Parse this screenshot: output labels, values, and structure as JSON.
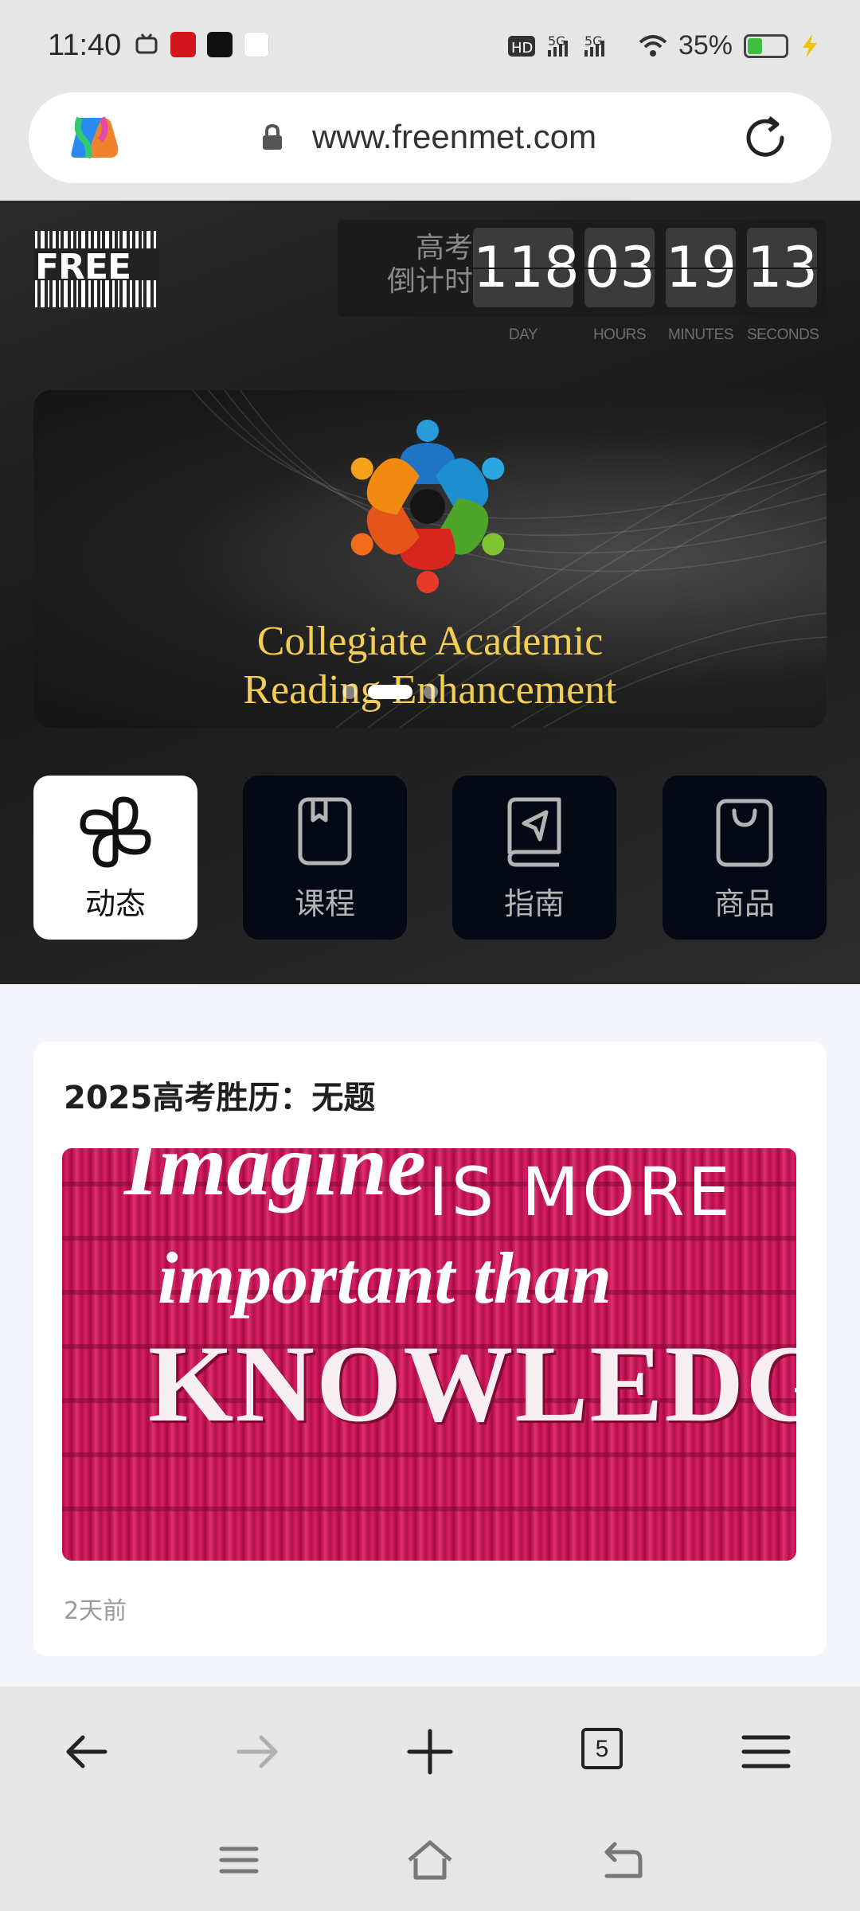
{
  "status_bar": {
    "time": "11:40",
    "network": "HD 5G 5G",
    "battery": "35%"
  },
  "address_bar": {
    "url": "www.freenmet.com"
  },
  "site": {
    "logo_text": "FREE",
    "countdown": {
      "label_line1": "高考",
      "label_line2": "倒计时",
      "days": "118",
      "hours": "03",
      "minutes": "19",
      "seconds": "13",
      "unit_day": "DAY",
      "unit_hours": "HOURS",
      "unit_minutes": "MINUTES",
      "unit_seconds": "SECONDS"
    },
    "banner": {
      "title_line1": "Collegiate Academic",
      "title_line2": "Reading Enhancement",
      "active_slide": 2,
      "slide_count": 4
    },
    "nav": [
      {
        "label": "动态",
        "icon": "pinwheel-icon",
        "active": true
      },
      {
        "label": "课程",
        "icon": "book-icon",
        "active": false
      },
      {
        "label": "指南",
        "icon": "guide-book-icon",
        "active": false
      },
      {
        "label": "商品",
        "icon": "shopping-bag-icon",
        "active": false
      }
    ]
  },
  "post": {
    "title": "2025高考胜历：无题",
    "image_text_line1": "Imagine",
    "image_text_line2": "IS MORE",
    "image_text_line3": "important than",
    "image_text_line4": "KNOWLEDGE",
    "time_ago": "2天前"
  },
  "browser_toolbar": {
    "tab_count": "5"
  },
  "colors": {
    "banner_title": "#f2cf54",
    "tile_dark": "#050815",
    "post_image": "#d61f63"
  }
}
